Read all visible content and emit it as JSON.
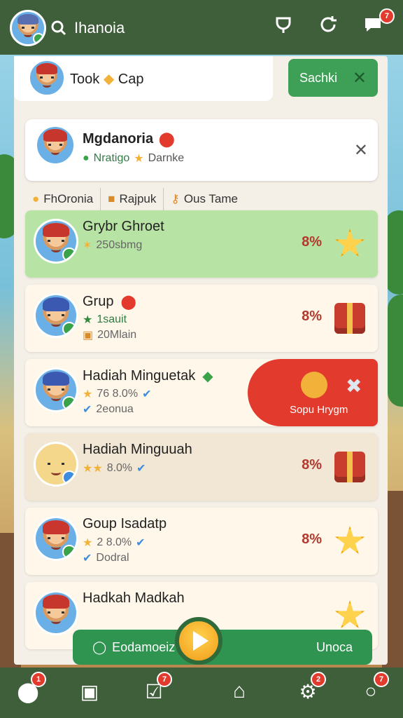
{
  "topbar": {
    "search_label": "Ihanoia",
    "notification_count": "7"
  },
  "header": {
    "user_label": "Took",
    "user_label_suffix": "Cap",
    "action_button_label": "Sachki"
  },
  "profile": {
    "name": "Mgdanoria",
    "sub_left": "Nratigo",
    "sub_right": "Darnke"
  },
  "filters": {
    "item1": "FhOronia",
    "item2": "Rajpuk",
    "item3": "Ous Tame"
  },
  "list": [
    {
      "title": "Grybr Ghroet",
      "line2": "250sbmg",
      "line3": "",
      "pct": "8%",
      "reward": "star-icon",
      "selected": true
    },
    {
      "title": "Grup",
      "line2": "1sauit",
      "line3": "20Mlain",
      "pct": "8%",
      "reward": "chest-icon",
      "selected": false
    },
    {
      "title": "Hadiah Minguetak",
      "line2": "76 8.0%",
      "line3": "2eonua",
      "pct": "",
      "reward": "",
      "selected": false,
      "swipe_label": "Sopu Hrygm"
    },
    {
      "title": "Hadiah Minguuah",
      "line2": "8.0%",
      "line3": "",
      "pct": "8%",
      "reward": "chest-icon",
      "selected": false
    },
    {
      "title": "Goup Isadatp",
      "line2": "2 8.0%",
      "line3": "Dodral",
      "pct": "8%",
      "reward": "star-icon",
      "selected": false
    },
    {
      "title": "Hadkah Madkah",
      "line2": "",
      "line3": "",
      "pct": "",
      "reward": "star-icon",
      "selected": false
    }
  ],
  "bottom_bar": {
    "left_label": "Eodamoeiz",
    "right_label": "Unoca"
  },
  "nav_badges": {
    "n1": "1",
    "n3": "7",
    "n5": "2",
    "n6": "7"
  }
}
